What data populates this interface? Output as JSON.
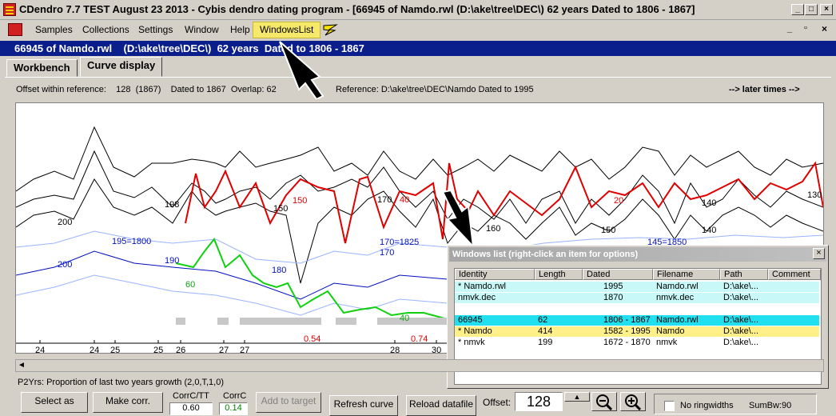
{
  "window": {
    "title": "CDendro 7.7 TEST August 23 2013 - Cybis dendro dating program - [66945 of Namdo.rwl    (D:\\ake\\tree\\DEC\\)  62 years  Dated to 1806 - 1867]",
    "controls": [
      "_",
      "□",
      "×"
    ]
  },
  "menu": {
    "items": [
      "Samples",
      "Collections",
      "Settings",
      "Window",
      "Help",
      "WindowsList"
    ],
    "mdi_controls": [
      "_",
      "▫",
      "×"
    ]
  },
  "docbar": "66945 of Namdo.rwl    (D:\\ake\\tree\\DEC\\)  62 years  Dated to 1806 - 1867",
  "tabs": [
    "Workbench",
    "Curve display"
  ],
  "info": {
    "offset": "Offset within reference:    128  (1867)    Dated to 1867  Overlap: 62",
    "reference": "Reference: D:\\ake\\tree\\DEC\\Namdo  Dated to 1995",
    "later": "--> later times -->"
  },
  "chart_data": {
    "type": "line",
    "labels_black": [
      "198",
      "200",
      "150",
      "170",
      "140",
      "150",
      "140",
      "130",
      "160"
    ],
    "labels_blue": [
      "190",
      "195=1800",
      "200",
      "180",
      "170=1825",
      "170",
      "145=1850"
    ],
    "labels_green": [
      "60",
      "40"
    ],
    "labels_red": [
      "150",
      "40",
      "20",
      "0.54",
      "0.74"
    ],
    "x_ticks": [
      "24",
      "24",
      "25",
      "25",
      "26",
      "27",
      "27",
      "28",
      "30"
    ]
  },
  "windows_list": {
    "caption": "Windows list  (right-click an item for options)",
    "close": "×",
    "columns": [
      "Identity",
      "Length",
      "Dated",
      "Filename",
      "Path",
      "Comment"
    ],
    "rows": [
      {
        "identity": "* Namdo.rwl",
        "length": "",
        "dated": "1995",
        "filename": "Namdo.rwl",
        "path": "D:\\ake\\...",
        "comment": "",
        "bg": "#c8f8f8"
      },
      {
        "identity": "   nmvk.dec",
        "length": "",
        "dated": "1870",
        "filename": "nmvk.dec",
        "path": "D:\\ake\\...",
        "comment": "",
        "bg": "#c8f8f8"
      },
      {
        "identity": "",
        "length": "",
        "dated": "",
        "filename": "",
        "path": "",
        "comment": "",
        "bg": "#ffffff"
      },
      {
        "identity": "   66945",
        "length": "62",
        "dated": "1806 - 1867",
        "filename": "Namdo.rwl",
        "path": "D:\\ake\\...",
        "comment": "",
        "bg": "#20e0f0"
      },
      {
        "identity": "* Namdo",
        "length": "414",
        "dated": "1582 - 1995",
        "filename": "Namdo",
        "path": "D:\\ake\\...",
        "comment": "",
        "bg": "#fff08a"
      },
      {
        "identity": "* nmvk",
        "length": "199",
        "dated": "1672 - 1870",
        "filename": "nmvk",
        "path": "D:\\ake\\...",
        "comment": "",
        "bg": "#ffffff"
      }
    ]
  },
  "bottom": {
    "status": "P2Yrs: Proportion of last two years growth (2,0,T,1,0)",
    "select_as": "Select as",
    "make_corr": "Make corr.",
    "corrc_tt": "CorrC/TT",
    "corrc": "CorrC",
    "corr_val1": "0.60",
    "corr_val2": "0.14",
    "add_to_target": "Add to target",
    "refresh": "Refresh curve",
    "reload": "Reload datafile",
    "offset_label": "Offset:",
    "offset_value": "128",
    "no_ringwidths": "No ringwidths",
    "sumbw": "SumBw:90"
  }
}
